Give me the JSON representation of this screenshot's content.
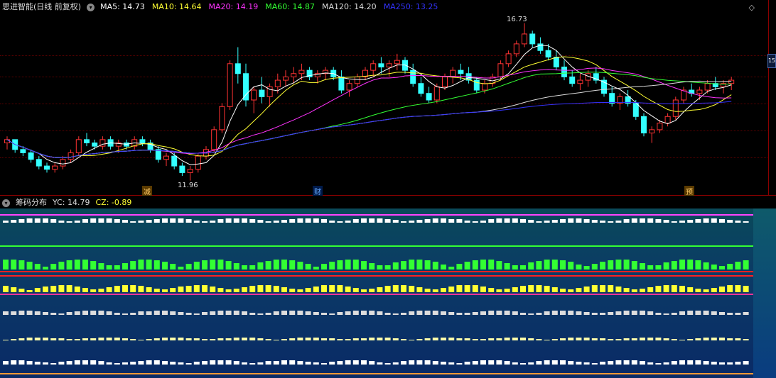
{
  "main_header": {
    "title": "思进智能(日线 前复权)",
    "indicators": [
      {
        "label": "MA5: 14.73",
        "color": "#ffffff"
      },
      {
        "label": "MA10: 14.64",
        "color": "#ffff33"
      },
      {
        "label": "MA20: 14.19",
        "color": "#ff33ff"
      },
      {
        "label": "MA60: 14.87",
        "color": "#33ff33"
      },
      {
        "label": "MA120: 14.20",
        "color": "#dddddd"
      },
      {
        "label": "MA250: 13.25",
        "color": "#3333ff"
      }
    ],
    "corner_icon": "diamond-icon",
    "side_tag": "15"
  },
  "price_annotations": {
    "high": "16.73",
    "low": "11.96"
  },
  "events": [
    {
      "label": "减",
      "color": "#ffcc66",
      "bg": "#5a3a00"
    },
    {
      "label": "财",
      "color": "#66aaff",
      "bg": "#001a4a"
    },
    {
      "label": "预",
      "color": "#ffcc66",
      "bg": "#5a3a00"
    }
  ],
  "chip_header": {
    "title": "筹码分布",
    "yc": "YC: 14.79",
    "cz": "CZ: -0.89"
  },
  "colors": {
    "up": "#ff3333",
    "down": "#33ffff",
    "grid": "#5a0000"
  },
  "chart_data": {
    "type": "candlestick",
    "high": 16.73,
    "low": 11.96,
    "candles": [
      [
        13.1,
        13.3,
        12.9,
        13.2
      ],
      [
        13.2,
        13.2,
        12.8,
        12.9
      ],
      [
        12.9,
        13.0,
        12.7,
        12.8
      ],
      [
        12.8,
        12.9,
        12.5,
        12.6
      ],
      [
        12.6,
        12.7,
        12.3,
        12.4
      ],
      [
        12.4,
        12.5,
        12.2,
        12.3
      ],
      [
        12.3,
        12.5,
        12.2,
        12.4
      ],
      [
        12.4,
        12.7,
        12.3,
        12.6
      ],
      [
        12.6,
        12.9,
        12.5,
        12.8
      ],
      [
        12.8,
        13.3,
        12.7,
        13.2
      ],
      [
        13.2,
        13.4,
        13.0,
        13.1
      ],
      [
        13.1,
        13.2,
        12.9,
        13.0
      ],
      [
        13.0,
        13.3,
        12.9,
        13.2
      ],
      [
        13.2,
        13.3,
        12.9,
        13.0
      ],
      [
        13.0,
        13.2,
        12.8,
        13.1
      ],
      [
        13.1,
        13.2,
        12.9,
        13.0
      ],
      [
        13.0,
        13.3,
        12.9,
        13.2
      ],
      [
        13.2,
        13.3,
        13.0,
        13.1
      ],
      [
        13.1,
        13.2,
        12.8,
        12.9
      ],
      [
        12.9,
        13.0,
        12.5,
        12.6
      ],
      [
        12.6,
        12.8,
        12.4,
        12.7
      ],
      [
        12.7,
        12.8,
        12.3,
        12.4
      ],
      [
        12.4,
        12.5,
        12.1,
        12.2
      ],
      [
        12.2,
        12.4,
        11.96,
        12.3
      ],
      [
        12.3,
        12.8,
        12.2,
        12.7
      ],
      [
        12.7,
        13.0,
        12.6,
        12.9
      ],
      [
        12.9,
        13.6,
        12.8,
        13.5
      ],
      [
        13.5,
        14.3,
        13.4,
        14.2
      ],
      [
        14.2,
        15.6,
        14.1,
        15.5
      ],
      [
        15.5,
        16.0,
        14.9,
        15.2
      ],
      [
        15.2,
        15.5,
        14.2,
        14.4
      ],
      [
        14.4,
        14.8,
        14.0,
        14.7
      ],
      [
        14.7,
        15.1,
        14.3,
        14.5
      ],
      [
        14.5,
        14.9,
        14.2,
        14.8
      ],
      [
        14.8,
        15.2,
        14.6,
        15.0
      ],
      [
        15.0,
        15.3,
        14.8,
        15.1
      ],
      [
        15.1,
        15.4,
        14.9,
        15.2
      ],
      [
        15.2,
        15.5,
        15.0,
        15.3
      ],
      [
        15.3,
        15.4,
        15.0,
        15.1
      ],
      [
        15.1,
        15.3,
        14.9,
        15.2
      ],
      [
        15.2,
        15.4,
        15.0,
        15.3
      ],
      [
        15.3,
        15.4,
        15.0,
        15.1
      ],
      [
        15.1,
        15.3,
        14.6,
        14.7
      ],
      [
        14.7,
        15.0,
        14.5,
        14.9
      ],
      [
        14.9,
        15.2,
        14.8,
        15.1
      ],
      [
        15.1,
        15.4,
        15.0,
        15.3
      ],
      [
        15.3,
        15.6,
        15.1,
        15.5
      ],
      [
        15.5,
        15.7,
        15.2,
        15.4
      ],
      [
        15.4,
        15.6,
        15.1,
        15.5
      ],
      [
        15.5,
        15.8,
        15.3,
        15.6
      ],
      [
        15.6,
        15.7,
        15.2,
        15.3
      ],
      [
        15.3,
        15.5,
        14.8,
        14.9
      ],
      [
        14.9,
        15.1,
        14.5,
        14.6
      ],
      [
        14.6,
        14.8,
        14.3,
        14.4
      ],
      [
        14.4,
        14.9,
        14.3,
        14.8
      ],
      [
        14.8,
        15.2,
        14.7,
        15.1
      ],
      [
        15.1,
        15.4,
        14.9,
        15.3
      ],
      [
        15.3,
        15.5,
        15.0,
        15.2
      ],
      [
        15.2,
        15.4,
        14.9,
        15.0
      ],
      [
        15.0,
        15.1,
        14.6,
        14.7
      ],
      [
        14.7,
        15.0,
        14.6,
        14.9
      ],
      [
        14.9,
        15.2,
        14.8,
        15.1
      ],
      [
        15.1,
        15.6,
        15.0,
        15.5
      ],
      [
        15.5,
        15.9,
        15.4,
        15.8
      ],
      [
        15.8,
        16.2,
        15.7,
        16.1
      ],
      [
        16.1,
        16.73,
        16.0,
        16.4
      ],
      [
        16.4,
        16.5,
        16.0,
        16.1
      ],
      [
        16.1,
        16.3,
        15.8,
        15.9
      ],
      [
        15.9,
        16.1,
        15.6,
        15.7
      ],
      [
        15.7,
        15.9,
        15.3,
        15.4
      ],
      [
        15.4,
        15.6,
        15.0,
        15.1
      ],
      [
        15.1,
        15.3,
        14.8,
        14.9
      ],
      [
        14.9,
        15.2,
        14.7,
        15.0
      ],
      [
        15.0,
        15.3,
        14.8,
        15.2
      ],
      [
        15.2,
        15.4,
        14.9,
        15.0
      ],
      [
        15.0,
        15.1,
        14.5,
        14.6
      ],
      [
        14.6,
        14.8,
        14.2,
        14.3
      ],
      [
        14.3,
        14.6,
        14.1,
        14.5
      ],
      [
        14.5,
        14.7,
        14.2,
        14.3
      ],
      [
        14.3,
        14.4,
        13.8,
        13.9
      ],
      [
        13.9,
        14.0,
        13.3,
        13.4
      ],
      [
        13.4,
        13.6,
        13.1,
        13.5
      ],
      [
        13.5,
        13.8,
        13.4,
        13.7
      ],
      [
        13.7,
        14.0,
        13.6,
        13.9
      ],
      [
        13.9,
        14.5,
        13.8,
        14.4
      ],
      [
        14.4,
        14.8,
        14.3,
        14.7
      ],
      [
        14.7,
        14.9,
        14.5,
        14.6
      ],
      [
        14.6,
        14.8,
        14.4,
        14.7
      ],
      [
        14.7,
        15.0,
        14.6,
        14.9
      ],
      [
        14.9,
        15.1,
        14.7,
        14.8
      ],
      [
        14.8,
        15.0,
        14.6,
        14.9
      ],
      [
        14.9,
        15.1,
        14.7,
        15.0
      ]
    ]
  }
}
